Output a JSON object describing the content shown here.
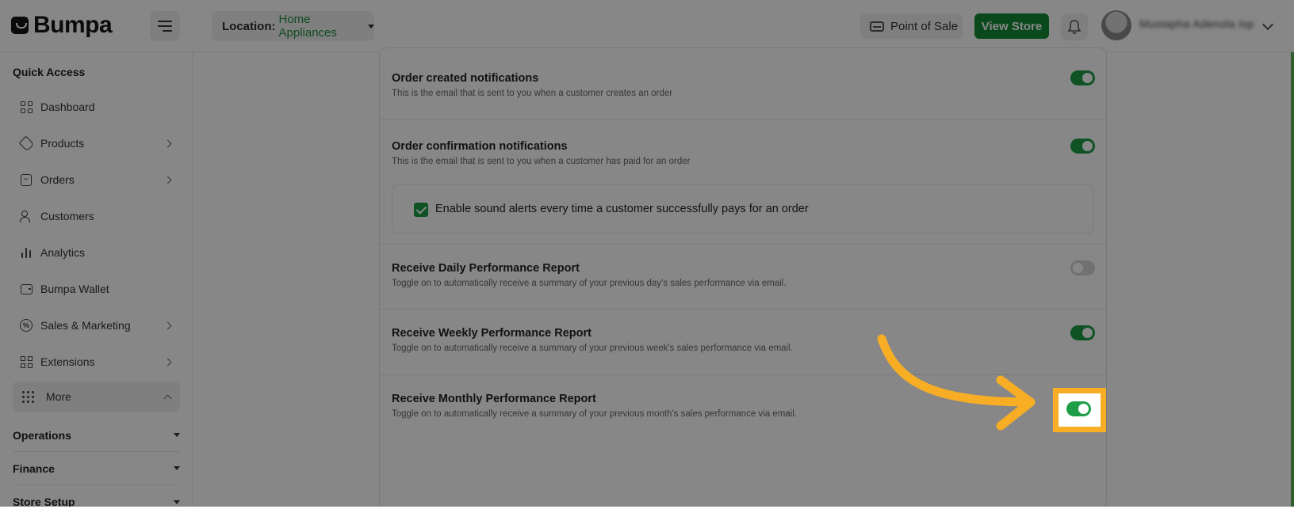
{
  "header": {
    "brand": "Bumpa",
    "location_label": "Location:",
    "location_value": "Home Appliances",
    "pos_label": "Point of Sale",
    "view_store_label": "View Store",
    "user_name": "Mustapha Adenola Isp"
  },
  "sidebar": {
    "quick_access": "Quick Access",
    "items": [
      {
        "label": "Dashboard",
        "icon": "dashboard-icon"
      },
      {
        "label": "Products",
        "icon": "tag-icon"
      },
      {
        "label": "Orders",
        "icon": "orders-icon"
      },
      {
        "label": "Customers",
        "icon": "customers-icon"
      },
      {
        "label": "Analytics",
        "icon": "analytics-icon"
      },
      {
        "label": "Bumpa Wallet",
        "icon": "wallet-icon"
      },
      {
        "label": "Sales & Marketing",
        "icon": "percent-icon"
      },
      {
        "label": "Extensions",
        "icon": "extensions-icon"
      },
      {
        "label": "More",
        "icon": "dots-grid-icon"
      }
    ],
    "groups": [
      "Operations",
      "Finance",
      "Store Setup"
    ]
  },
  "settings": {
    "rows": [
      {
        "title": "Order created notifications",
        "desc": "This is the email that is sent to you when a customer creates an order",
        "enabled": true
      },
      {
        "title": "Order confirmation notifications",
        "desc": "This is the email that is sent to you when a customer has paid for an order",
        "enabled": true
      },
      {
        "title": "Receive Daily Performance Report",
        "desc": "Toggle on to automatically receive a summary of your previous day's sales performance via email.",
        "enabled": false
      },
      {
        "title": "Receive Weekly Performance Report",
        "desc": "Toggle on to automatically receive a summary of your previous week's sales performance via email.",
        "enabled": true
      },
      {
        "title": "Receive Monthly Performance Report",
        "desc": "Toggle on to automatically receive a summary of your previous month's sales performance via email.",
        "enabled": true
      }
    ],
    "sound_alert": {
      "label": "Enable sound alerts every time a customer successfully pays for an order",
      "checked": true
    }
  },
  "colors": {
    "accent": "#138a36",
    "toggle_on": "#1e9e46",
    "annotation": "#f7ae25"
  }
}
